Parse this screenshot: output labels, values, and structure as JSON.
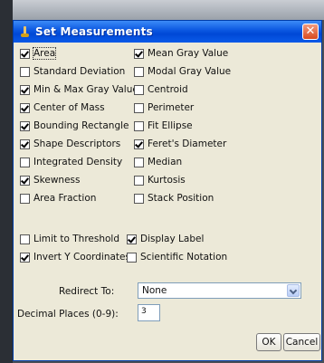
{
  "window": {
    "title": "Set Measurements",
    "close_glyph": "✕"
  },
  "measurements": [
    {
      "label": "Area",
      "checked": true
    },
    {
      "label": "Mean Gray Value",
      "checked": true
    },
    {
      "label": "Standard Deviation",
      "checked": false
    },
    {
      "label": "Modal Gray Value",
      "checked": false
    },
    {
      "label": "Min & Max Gray Value",
      "checked": true
    },
    {
      "label": "Centroid",
      "checked": false
    },
    {
      "label": "Center of Mass",
      "checked": true
    },
    {
      "label": "Perimeter",
      "checked": false
    },
    {
      "label": "Bounding Rectangle",
      "checked": true
    },
    {
      "label": "Fit Ellipse",
      "checked": false
    },
    {
      "label": "Shape Descriptors",
      "checked": true
    },
    {
      "label": "Feret's Diameter",
      "checked": true
    },
    {
      "label": "Integrated Density",
      "checked": false
    },
    {
      "label": "Median",
      "checked": false
    },
    {
      "label": "Skewness",
      "checked": true
    },
    {
      "label": "Kurtosis",
      "checked": false
    },
    {
      "label": "Area Fraction",
      "checked": false
    },
    {
      "label": "Stack Position",
      "checked": false
    }
  ],
  "options": [
    {
      "label": "Limit to Threshold",
      "checked": false
    },
    {
      "label": "Display Label",
      "checked": true
    },
    {
      "label": "Invert Y Coordinates",
      "checked": true
    },
    {
      "label": "Scientific Notation",
      "checked": false
    }
  ],
  "redirect": {
    "label": "Redirect To:",
    "value": "None"
  },
  "decimal": {
    "label": "Decimal Places (0-9):",
    "value": "3"
  },
  "buttons": {
    "ok": "OK",
    "cancel": "Cancel"
  }
}
